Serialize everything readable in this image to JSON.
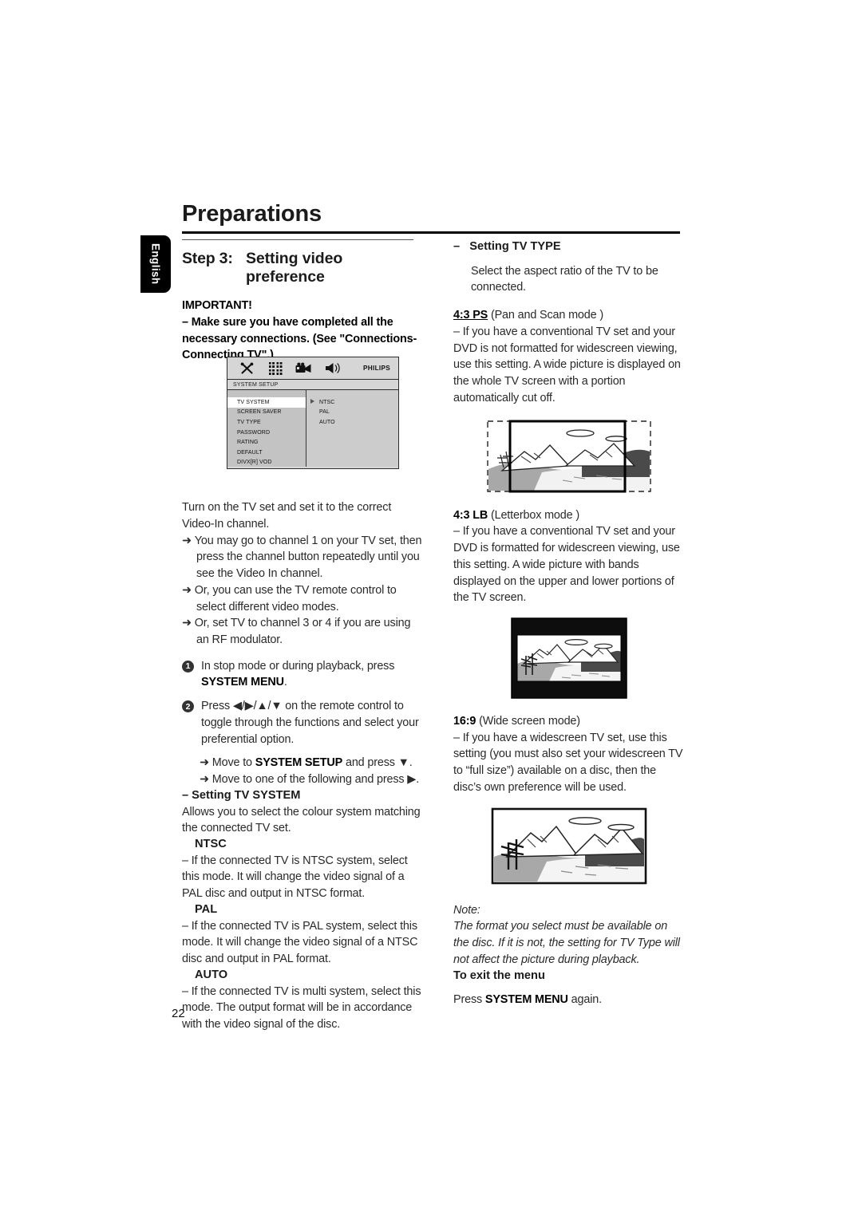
{
  "meta": {
    "page_number": "22",
    "language_tab": "English"
  },
  "header": {
    "chapter_title": "Preparations"
  },
  "left_column": {
    "step_label": "Step 3:",
    "step_title_line1": "Setting video",
    "step_title_line2": "preference",
    "important_heading": "IMPORTANT!",
    "important_body": "–  Make sure you have completed all the necessary connections. (See \"Connections-Connecting TV\".)",
    "osd": {
      "icons": [
        "tools-icon",
        "grid-icon",
        "camcorder-icon",
        "speaker-icon"
      ],
      "brand": "PHILIPS",
      "title_bar": "SYSTEM SETUP",
      "menu_items": [
        "TV SYSTEM",
        "SCREEN SAVER",
        "TV TYPE",
        "PASSWORD",
        "RATING",
        "DEFAULT",
        "DIVX[R] VOD"
      ],
      "selected_item": "TV SYSTEM",
      "options": [
        "NTSC",
        "PAL",
        "AUTO"
      ]
    },
    "intro_paragraph": "Turn on the TV set and set it to the correct Video-In channel.",
    "arrow_items": [
      "You may go to channel 1 on your TV set, then press the channel button repeatedly until you see the Video In channel.",
      "Or, you can use the TV remote control to select different video modes.",
      "Or, set TV to channel 3 or 4 if you are using an RF modulator."
    ],
    "steps": [
      {
        "num": "1",
        "text_before": "In stop mode or during playback, press ",
        "bold": "SYSTEM MENU",
        "text_after": "."
      },
      {
        "num": "2",
        "text_before": "Press ◀/▶/▲/▼ on the remote control to toggle through the functions and select your preferential option.",
        "bold": "",
        "text_after": ""
      }
    ],
    "sub_arrows": [
      {
        "pre": "Move to ",
        "bold": "SYSTEM SETUP",
        "post": " and press ▼."
      },
      {
        "pre": "Move to one of the following and press ▶.",
        "bold": "",
        "post": ""
      }
    ],
    "tv_system": {
      "heading": "–  Setting TV SYSTEM",
      "body": "Allows you to select the colour system matching the connected TV set.",
      "modes": [
        {
          "name": "NTSC",
          "desc": "–   If the connected TV is NTSC system, select this mode. It will change the video signal of a PAL disc and output in NTSC format."
        },
        {
          "name": "PAL",
          "desc": "–   If the connected TV is PAL system, select this mode. It will change the video signal of a NTSC disc and output in PAL format."
        },
        {
          "name": "AUTO",
          "desc": "–   If the connected TV is multi system, select this mode. The output format will be in accordance with the video signal of the disc."
        }
      ]
    }
  },
  "right_column": {
    "tv_type_heading_dash": "–",
    "tv_type_heading": "Setting TV TYPE",
    "tv_type_intro": "Select the aspect ratio of the TV to be connected.",
    "modes": [
      {
        "label": "4:3 PS",
        "label_style": "underline",
        "mode_name": "(Pan and Scan mode )",
        "desc": "–   If you have a conventional TV set and your DVD is not formatted for widescreen viewing, use this setting.  A wide picture is displayed on the whole TV screen with a portion automatically cut off.",
        "figure": "pan-and-scan-figure"
      },
      {
        "label": "4:3 LB",
        "label_style": "bold",
        "mode_name": "(Letterbox mode )",
        "desc": "–   If you have a conventional TV set and your DVD is formatted for widescreen viewing, use this setting.  A wide picture with bands displayed on the upper and lower portions of the TV screen.",
        "figure": "letterbox-figure"
      },
      {
        "label": "16:9",
        "label_style": "bold",
        "mode_name": "(Wide screen mode)",
        "desc": "–   If you have a widescreen TV set, use this setting (you must also set your widescreen TV to “full size”) available on a disc, then the disc’s own preference will be used.",
        "figure": "widescreen-figure"
      }
    ],
    "note_label": "Note:",
    "note_body": "The format you select must be available on the disc. If it is not, the setting for TV Type will not affect the picture during playback.",
    "exit_heading": "To exit the menu",
    "exit_pre": "Press ",
    "exit_bold": "SYSTEM MENU",
    "exit_post": " again."
  }
}
